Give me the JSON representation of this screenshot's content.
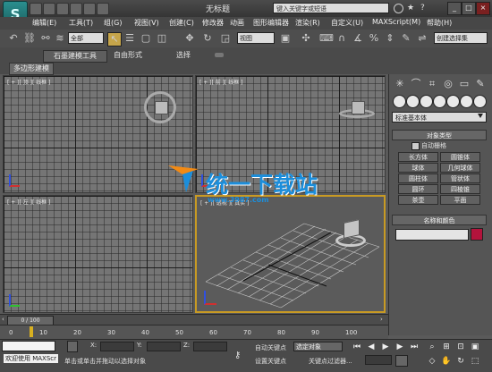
{
  "title_bar": {
    "title": "无标题",
    "search_placeholder": "键入关键字或短语",
    "logo_glyph": "S",
    "window_controls": [
      "_",
      "□",
      "×"
    ]
  },
  "menu": {
    "items": [
      "编辑(E)",
      "工具(T)",
      "组(G)",
      "视图(V)",
      "创建(C)",
      "修改器",
      "动画",
      "图形编辑器",
      "渲染(R)",
      "自定义(U)",
      "MAXScript(M)",
      "帮助(H)"
    ]
  },
  "toolbar": {
    "filter_value": "全部",
    "coord_value": "视图",
    "named_selection": "创建选择集"
  },
  "ribbon": {
    "tabs": [
      "石墨建模工具",
      "自由形式",
      "选择"
    ],
    "subtab": "多边形建模"
  },
  "viewports": [
    {
      "id": "top",
      "label": "[ + ][ 顶 ][ 线框 ]"
    },
    {
      "id": "front",
      "label": "[ + ][ 前 ][ 线框 ]"
    },
    {
      "id": "left",
      "label": "[ + ][ 左 ][ 线框 ]"
    },
    {
      "id": "perspective",
      "label": "[ + ][ 透视 ][ 真实 ]"
    }
  ],
  "command_panel": {
    "category": "标准基本体",
    "object_type": {
      "title": "对象类型",
      "autogrid": "自动栅格",
      "buttons": [
        "长方体",
        "圆锥体",
        "球体",
        "几何球体",
        "圆柱体",
        "管状体",
        "圆环",
        "四棱锥",
        "茶壶",
        "平面"
      ]
    },
    "name_color": {
      "title": "名称和颜色",
      "color": "#b3133c"
    }
  },
  "timeline": {
    "frame_label": "0 / 100",
    "ticks": [
      "0",
      "10",
      "20",
      "30",
      "40",
      "50",
      "60",
      "70",
      "80",
      "90",
      "100"
    ]
  },
  "status": {
    "welcome": "欢迎使用 MAXScr",
    "prompt": "单击或单击并拖动以选择对象",
    "x_label": "X:",
    "y_label": "Y:",
    "z_label": "Z:",
    "auto_key": "自动关键点",
    "set_key": "设置关键点",
    "key_mode": "选定对象",
    "key_filter": "关键点过滤器..."
  },
  "watermark": {
    "text": "统一下载站",
    "url": "www.3987.com"
  },
  "colors": {
    "selected_viewport_border": "#c89a23",
    "gizmo_x": "#d03030",
    "gizmo_y": "#30c030",
    "gizmo_z": "#3050e0"
  }
}
